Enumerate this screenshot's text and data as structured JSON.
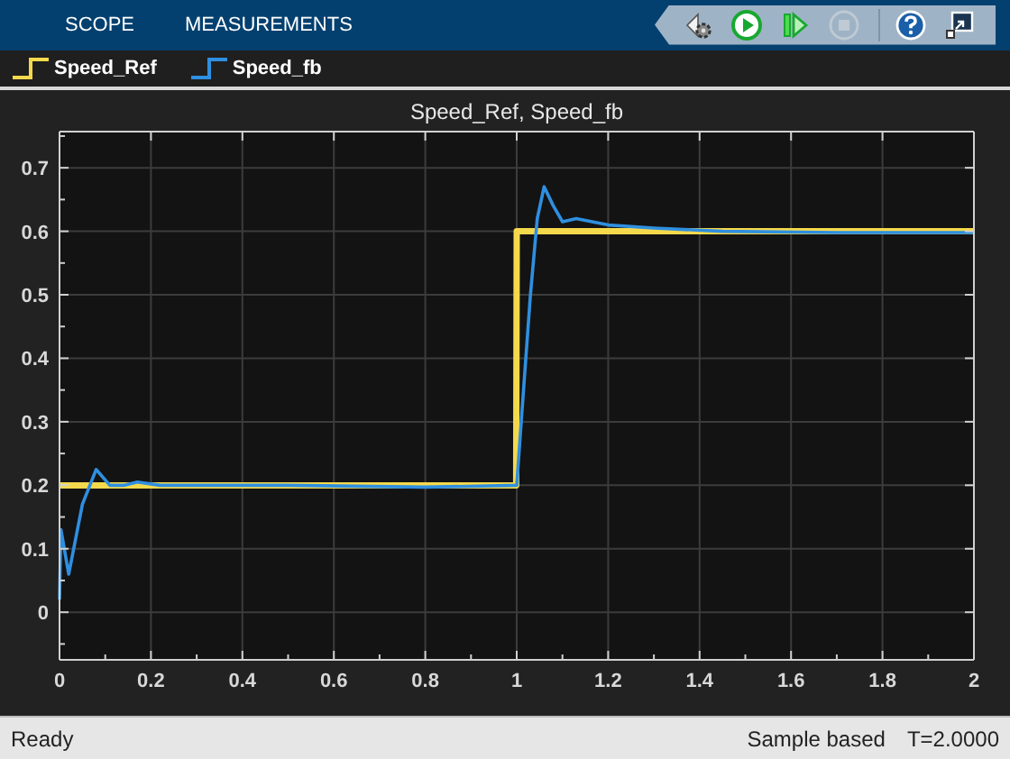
{
  "toolstrip": {
    "tabs": [
      {
        "label": "SCOPE",
        "selected": false
      },
      {
        "label": "MEASUREMENTS",
        "selected": false
      }
    ],
    "buttons": [
      {
        "kind": "settings",
        "disabled": false
      },
      {
        "kind": "run",
        "disabled": false
      },
      {
        "kind": "step",
        "disabled": false
      },
      {
        "kind": "stop",
        "disabled": true
      },
      {
        "kind": "help",
        "disabled": false
      },
      {
        "kind": "undock",
        "disabled": false
      }
    ]
  },
  "plot": {
    "chart_data": {
      "type": "line",
      "title": "Speed_Ref, Speed_fb",
      "x": [
        0,
        0.003,
        0.02,
        0.05,
        0.08,
        0.11,
        0.14,
        0.17,
        0.22,
        0.5,
        0.8,
        0.999,
        1.0,
        1.01,
        1.03,
        1.045,
        1.06,
        1.08,
        1.1,
        1.13,
        1.2,
        1.3,
        1.45,
        1.7,
        2.0
      ],
      "series": [
        {
          "name": "Speed_Ref",
          "color": "#f5d94c",
          "values": [
            0.2,
            0.2,
            0.2,
            0.2,
            0.2,
            0.2,
            0.2,
            0.2,
            0.2,
            0.2,
            0.2,
            0.2,
            0.6,
            0.6,
            0.6,
            0.6,
            0.6,
            0.6,
            0.6,
            0.6,
            0.6,
            0.6,
            0.6,
            0.6,
            0.6
          ]
        },
        {
          "name": "Speed_fb",
          "color": "#2f8fe0",
          "values": [
            0.02,
            0.13,
            0.06,
            0.17,
            0.225,
            0.2,
            0.2,
            0.205,
            0.2,
            0.2,
            0.197,
            0.2,
            0.2,
            0.3,
            0.5,
            0.62,
            0.67,
            0.64,
            0.615,
            0.62,
            0.61,
            0.605,
            0.6,
            0.598,
            0.598
          ]
        }
      ],
      "xlim": [
        0,
        2
      ],
      "ylim": [
        -0.075,
        0.757
      ],
      "xticks": [
        0,
        0.2,
        0.4,
        0.6,
        0.8,
        1,
        1.2,
        1.4,
        1.6,
        1.8,
        2
      ],
      "yticks": [
        0,
        0.1,
        0.2,
        0.3,
        0.4,
        0.5,
        0.6,
        0.7
      ],
      "grid": true
    }
  },
  "status_bar": {
    "state": "Ready",
    "mode": "Sample based",
    "time": "T=2.0000"
  }
}
